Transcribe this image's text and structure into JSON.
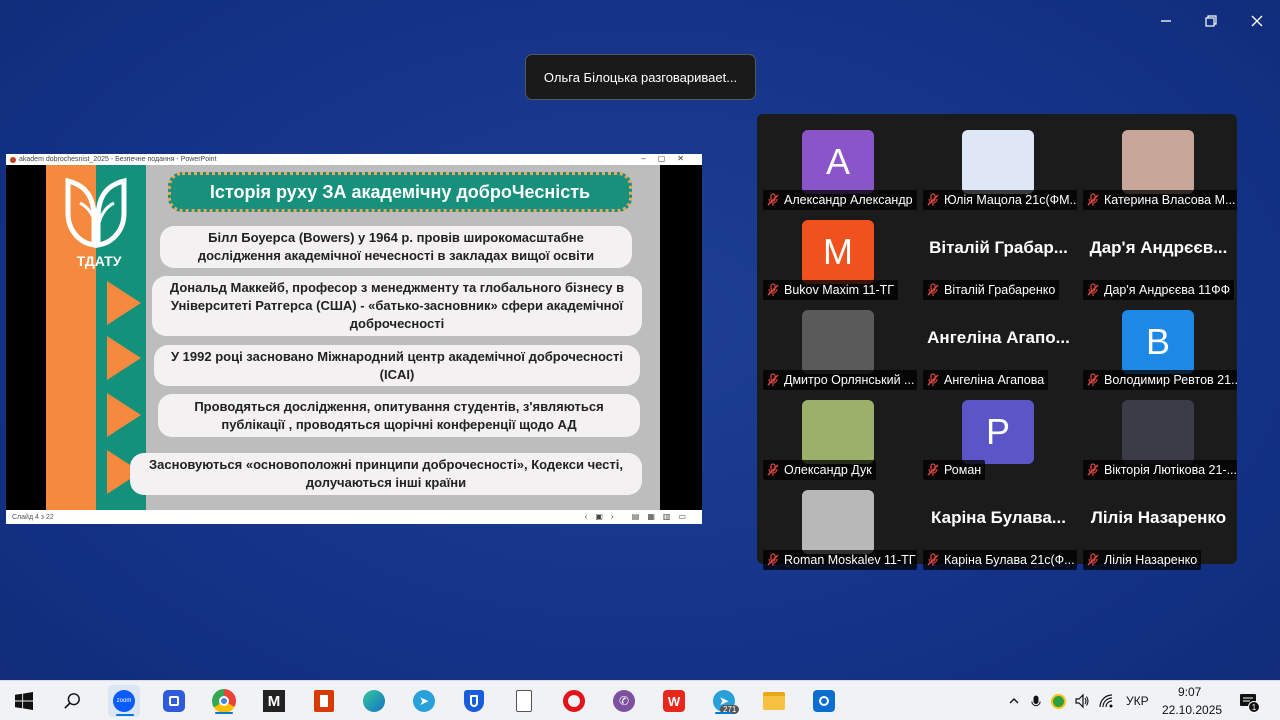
{
  "window": {
    "controls": [
      "minimize-icon",
      "restore-icon",
      "close-icon"
    ]
  },
  "toast": {
    "text": "Ольга Білоцька разговариваеt..."
  },
  "share": {
    "ppt_title": "akadem dobrochesnist_2025 - Безпечне подання - PowerPoint",
    "status_left": "Слайд 4 з 22",
    "logo_text": "ТДАТУ",
    "slide_title": "Історія руху ЗА академічну доброЧесність",
    "bullets": [
      "Білл Боуерса (Bowers) у 1964 р. провів широкомасштабне дослідження академічної нечесності в закладах вищої освіти",
      "Дональд Маккейб, професор з менеджменту та глобального бізнесу в Університеті Ратгерса (США) - «батько-засновник» сфери академічної доброчесності",
      "У 1992 році засновано Міжнародний центр академічної доброчесності (ICAI)",
      "Проводяться дослідження, опитування студентів, з'являються публікації , проводяться щорічні конференції щодо АД",
      "Засновуються «основоположні принципи доброчесності», Кодекси честі, долучаються інші країни"
    ]
  },
  "gallery": {
    "participants": [
      {
        "name": "Александр Александр",
        "avatar_letter": "A",
        "avatar_color": "#8a55c9",
        "big_name": ""
      },
      {
        "name": "Юлія Мацола 21с(ФМ...",
        "avatar_letter": "",
        "avatar_color": "#dfe6f5",
        "big_name": ""
      },
      {
        "name": "Катерина Власова М...",
        "avatar_letter": "",
        "avatar_color": "#c9a69a",
        "big_name": ""
      },
      {
        "name": "Bukov Maxim 11-ТГ",
        "avatar_letter": "M",
        "avatar_color": "#f0521e",
        "big_name": ""
      },
      {
        "name": "Віталій Грабаренко",
        "avatar_letter": "",
        "avatar_color": "",
        "big_name": "Віталій Грабар..."
      },
      {
        "name": "Дар'я Андрєєва 11ФФ",
        "avatar_letter": "",
        "avatar_color": "",
        "big_name": "Дар'я Андрєєв..."
      },
      {
        "name": "Дмитро Орлянський ...",
        "avatar_letter": "",
        "avatar_color": "#5a5a5a",
        "big_name": ""
      },
      {
        "name": "Ангеліна Агапова",
        "avatar_letter": "",
        "avatar_color": "",
        "big_name": "Ангеліна Агапо..."
      },
      {
        "name": "Володимир Ревтов 21...",
        "avatar_letter": "B",
        "avatar_color": "#1e88e5",
        "big_name": ""
      },
      {
        "name": "Олександр Дук",
        "avatar_letter": "",
        "avatar_color": "#9cb06a",
        "big_name": ""
      },
      {
        "name": "Роман",
        "avatar_letter": "P",
        "avatar_color": "#5b55c8",
        "big_name": ""
      },
      {
        "name": "Вікторія Лютікова 21-...",
        "avatar_letter": "",
        "avatar_color": "#3b3b48",
        "big_name": ""
      },
      {
        "name": "Roman Moskalev 11-ТГ",
        "avatar_letter": "",
        "avatar_color": "#b8b8b8",
        "big_name": ""
      },
      {
        "name": "Каріна Булава 21с(Ф...",
        "avatar_letter": "",
        "avatar_color": "",
        "big_name": "Каріна Булава..."
      },
      {
        "name": "Лілія Назаренко",
        "avatar_letter": "",
        "avatar_color": "",
        "big_name": "Лілія Назаренко"
      }
    ]
  },
  "taskbar": {
    "apps": [
      "start-icon",
      "search-icon",
      "zoom-icon",
      "teams-icon",
      "chrome-icon",
      "m-app-icon",
      "office-icon",
      "edge-icon",
      "telegram-icon",
      "bitwarden-icon",
      "file-icon",
      "opera-icon",
      "viber-icon",
      "wps-icon",
      "telegram-2-icon",
      "explorer-icon",
      "security-icon"
    ],
    "zoom_label": "zoom",
    "telegram_badge": "271",
    "lang": "УКР",
    "time": "9:07",
    "date": "22.10.2025",
    "notif_count": "1"
  }
}
